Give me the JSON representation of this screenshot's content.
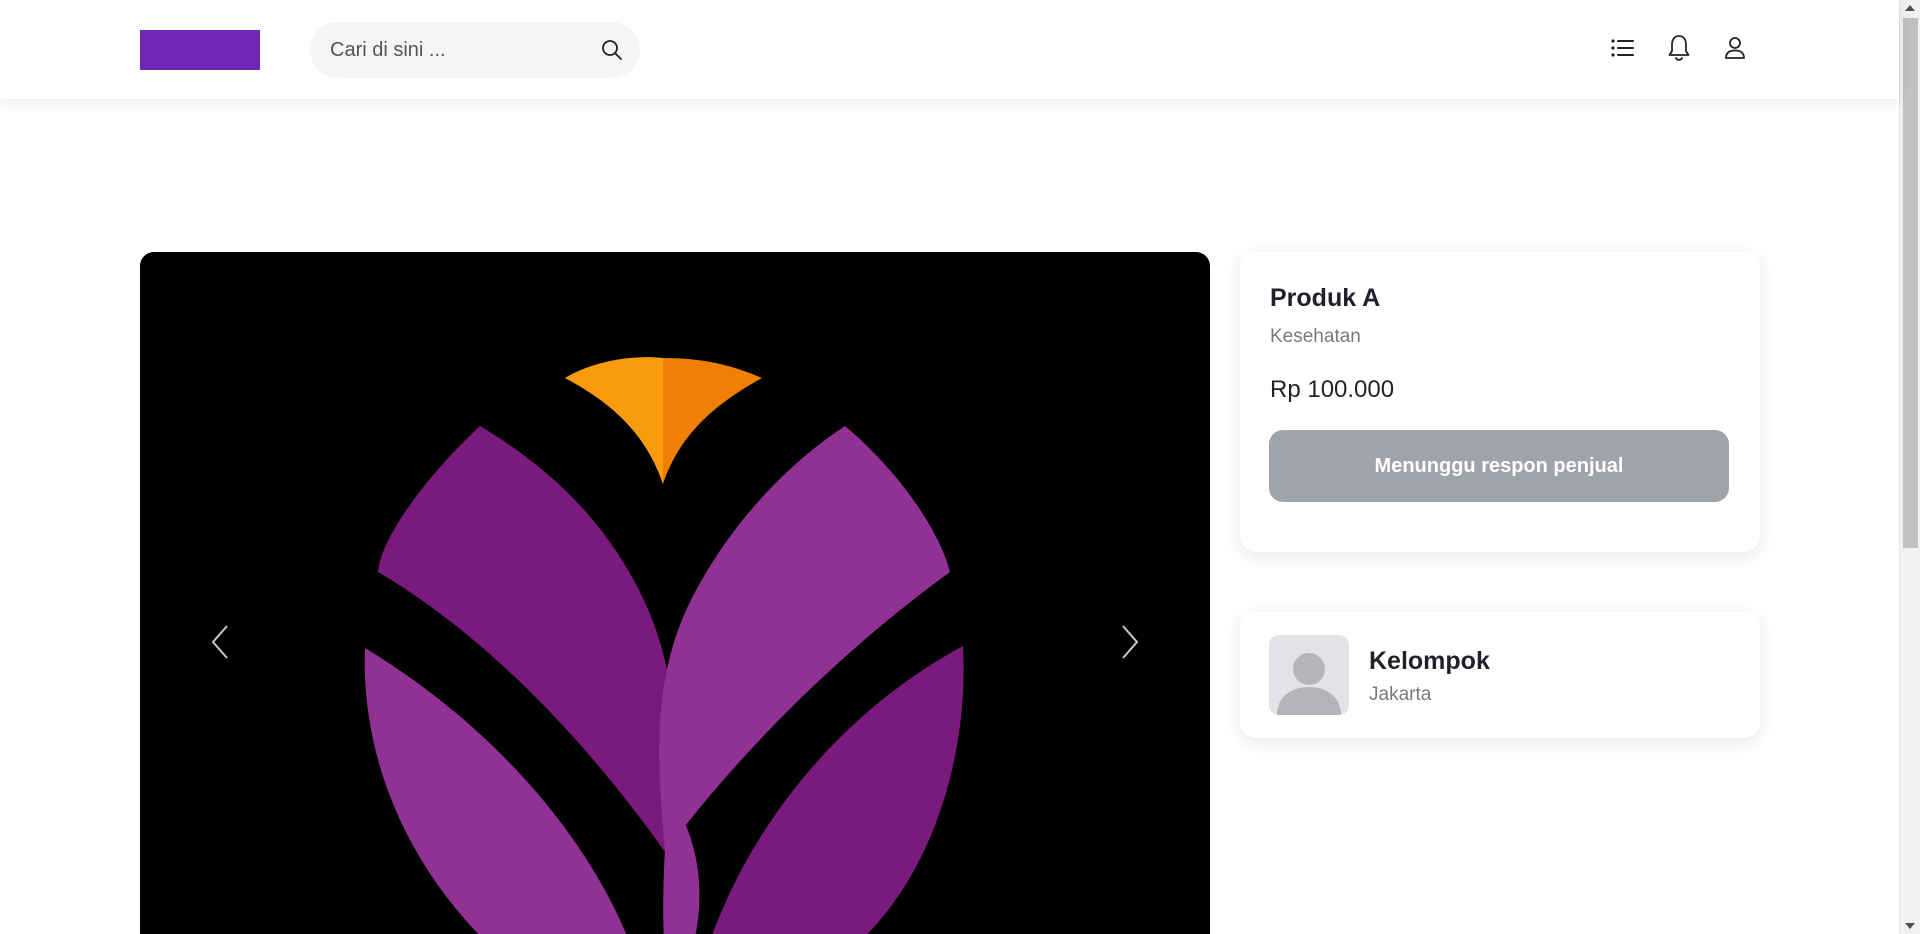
{
  "header": {
    "search": {
      "placeholder": "Cari di sini ...",
      "value": ""
    },
    "icons": [
      "list-icon",
      "bell-icon",
      "user-icon"
    ]
  },
  "colors": {
    "brand": "#7226b7",
    "button_disabled": "#a0a4aa",
    "petal_dark": "#7a1a7d",
    "petal_light": "#923194",
    "accent_orange": "#f98f0c"
  },
  "product": {
    "name": "Produk A",
    "category": "Kesehatan",
    "price": "Rp 100.000",
    "status_button": "Menunggu respon penjual"
  },
  "seller": {
    "name": "Kelompok",
    "location": "Jakarta"
  }
}
